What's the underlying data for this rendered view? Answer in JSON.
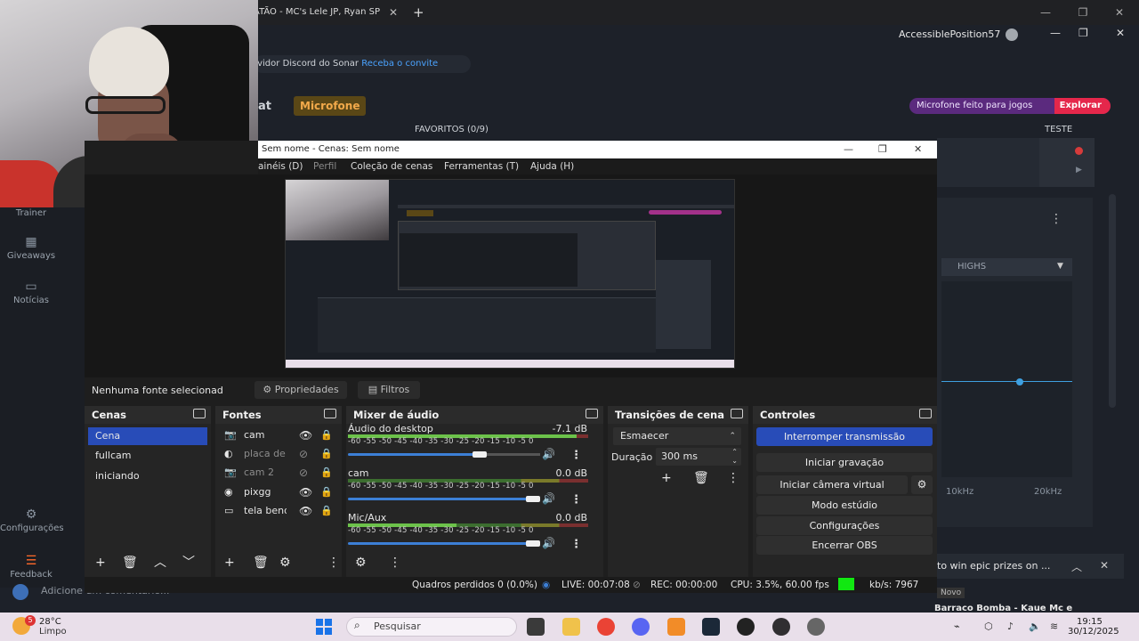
{
  "browser": {
    "tab_title": "ATÃO - MC's Lele JP, Ryan SP",
    "tab_close": "✕",
    "new_tab": "+",
    "minimize": "—",
    "restore": "❐",
    "close": "✕"
  },
  "page": {
    "account_name": "AccessiblePosition57",
    "discord_text": "rvidor Discord do Sonar",
    "discord_link": "Receba o convite",
    "heading_partial": "at",
    "tab_microfone": "Microfone",
    "favoritos": "FAVORITOS (0/9)",
    "promo_text": "Microfone feito para jogos",
    "promo_link": "Explorar",
    "teste": "TESTE",
    "eq_band": "HIGHS",
    "freq_10k": "10kHz",
    "freq_20k": "20kHz",
    "ad_text": "to win epic prizes on ...",
    "comment_placeholder": "Adicione um comentário...",
    "yt_novo": "Novo",
    "yt_title": "Barraco Bomba - Kaue Mc e"
  },
  "sidebar": {
    "items": [
      {
        "label": "Trainer",
        "icon": "trainer-icon"
      },
      {
        "label": "Giveaways",
        "icon": "gift-icon"
      },
      {
        "label": "Notícias",
        "icon": "news-icon"
      },
      {
        "label": "Configurações",
        "icon": "gear-icon"
      },
      {
        "label": "Feedback",
        "icon": "feedback-icon"
      }
    ]
  },
  "obs": {
    "title": "Sem nome - Cenas: Sem nome",
    "menu": [
      "ainéis (D)",
      "Perfil",
      "Coleção de cenas",
      "Ferramentas (T)",
      "Ajuda (H)"
    ],
    "no_source": "Nenhuma fonte selecionad",
    "btn_properties": "Propriedades",
    "btn_filters": "Filtros",
    "docks": {
      "scenes": "Cenas",
      "sources": "Fontes",
      "mixer": "Mixer de áudio",
      "transitions": "Transições de cena",
      "controls": "Controles"
    },
    "scenes": [
      "Cena",
      "fullcam",
      "iniciando"
    ],
    "sources": [
      {
        "name": "cam",
        "icon": "camera-icon",
        "visible": true
      },
      {
        "name": "placa de v",
        "icon": "capture-card-icon",
        "visible": false
      },
      {
        "name": "cam 2",
        "icon": "camera-icon",
        "visible": false
      },
      {
        "name": "pixgg",
        "icon": "browser-icon",
        "visible": true
      },
      {
        "name": "tela benq",
        "icon": "display-icon",
        "visible": true
      }
    ],
    "mixer": [
      {
        "name": "Áudio do desktop",
        "db": "-7.1 dB",
        "level": 0.95,
        "volume": 0.7
      },
      {
        "name": "cam",
        "db": "0.0 dB",
        "level": 0.0,
        "volume": 1.0
      },
      {
        "name": "Mic/Aux",
        "db": "0.0 dB",
        "level": 0.45,
        "volume": 1.0
      }
    ],
    "ticks": "-60  -55  -50  -45  -40  -35  -30  -25  -20  -15  -10   -5    0",
    "transition": {
      "selected": "Esmaecer",
      "duration_label": "Duração",
      "duration_value": "300 ms"
    },
    "controls": {
      "stop_stream": "Interromper transmissão",
      "start_recording": "Iniciar gravação",
      "start_vcam": "Iniciar câmera virtual",
      "studio_mode": "Modo estúdio",
      "settings": "Configurações",
      "exit": "Encerrar OBS"
    },
    "status": {
      "dropped": "Quadros perdidos 0 (0.0%)",
      "live": "LIVE: 00:07:08",
      "rec": "REC: 00:00:00",
      "cpu": "CPU: 3.5%, 60.00 fps",
      "kbps": "kb/s: 7967"
    }
  },
  "taskbar": {
    "weather_badge": "5",
    "temp": "28°C",
    "weather": "Limpo",
    "search": "Pesquisar",
    "time": "19:15",
    "date": "30/12/2025"
  },
  "colors": {
    "accent_blue": "#284cb8",
    "live_green": "#11e811",
    "brand_orange": "#f2a94a"
  }
}
